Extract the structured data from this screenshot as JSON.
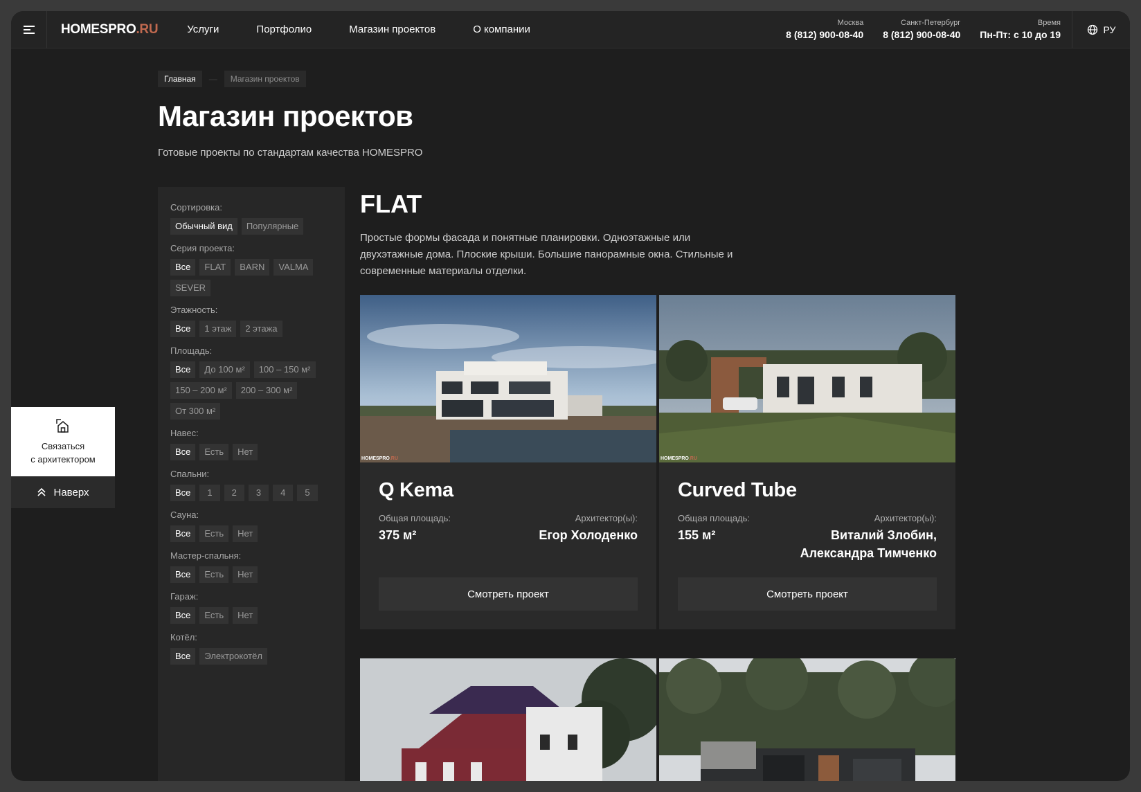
{
  "header": {
    "logo_main": "HOMESPRO",
    "logo_suffix": ".RU",
    "nav": [
      "Услуги",
      "Портфолио",
      "Магазин проектов",
      "О компании"
    ],
    "contacts": [
      {
        "city": "Москва",
        "value": "8 (812) 900-08-40"
      },
      {
        "city": "Санкт-Петербург",
        "value": "8 (812) 900-08-40"
      },
      {
        "city": "Время",
        "value": "Пн-Пт: с 10 до 19"
      }
    ],
    "lang": "РУ"
  },
  "breadcrumbs": [
    "Главная",
    "Магазин проектов"
  ],
  "page": {
    "title": "Магазин проектов",
    "subtitle": "Готовые проекты по стандартам качества HOMESPRO"
  },
  "filters": [
    {
      "label": "Сортировка:",
      "options": [
        "Обычный вид",
        "Популярные"
      ],
      "selected": 0
    },
    {
      "label": "Серия проекта:",
      "options": [
        "Все",
        "FLAT",
        "BARN",
        "VALMA",
        "SEVER"
      ],
      "selected": 0
    },
    {
      "label": "Этажность:",
      "options": [
        "Все",
        "1 этаж",
        "2 этажа"
      ],
      "selected": 0
    },
    {
      "label": "Площадь:",
      "options": [
        "Все",
        "До 100 м²",
        "100 – 150 м²",
        "150 – 200 м²",
        "200 – 300 м²",
        "От 300 м²"
      ],
      "selected": 0
    },
    {
      "label": "Навес:",
      "options": [
        "Все",
        "Есть",
        "Нет"
      ],
      "selected": 0
    },
    {
      "label": "Спальни:",
      "options": [
        "Все",
        "1",
        "2",
        "3",
        "4",
        "5"
      ],
      "selected": 0
    },
    {
      "label": "Сауна:",
      "options": [
        "Все",
        "Есть",
        "Нет"
      ],
      "selected": 0
    },
    {
      "label": "Мастер-спальня:",
      "options": [
        "Все",
        "Есть",
        "Нет"
      ],
      "selected": 0
    },
    {
      "label": "Гараж:",
      "options": [
        "Все",
        "Есть",
        "Нет"
      ],
      "selected": 0
    },
    {
      "label": "Котёл:",
      "options": [
        "Все",
        "Электрокотёл"
      ],
      "selected": 0
    }
  ],
  "widgets": {
    "contact_line1": "Связаться",
    "contact_line2": "с архитектором",
    "up": "Наверх"
  },
  "series": {
    "title": "FLAT",
    "description": "Простые формы фасада и понятные планировки. Одноэтажные или двухэтажные дома. Плоские крыши. Большие панорамные окна. Стильные и современные материалы отделки."
  },
  "cards": [
    {
      "name": "Q Kema",
      "area_label": "Общая площадь:",
      "area": "375 м²",
      "arch_label": "Архитектор(ы):",
      "architects": [
        "Егор Холоденко"
      ],
      "button": "Смотреть проект"
    },
    {
      "name": "Curved Tube",
      "area_label": "Общая площадь:",
      "area": "155 м²",
      "arch_label": "Архитектор(ы):",
      "architects": [
        "Виталий Злобин,",
        "Александра Тимченко"
      ],
      "button": "Смотреть проект"
    }
  ],
  "watermark": {
    "main": "HOMESPRO",
    "suffix": ".RU"
  },
  "colors": {
    "accent": "#c0694f",
    "background": "#1e1e1e",
    "panel": "#272727"
  }
}
